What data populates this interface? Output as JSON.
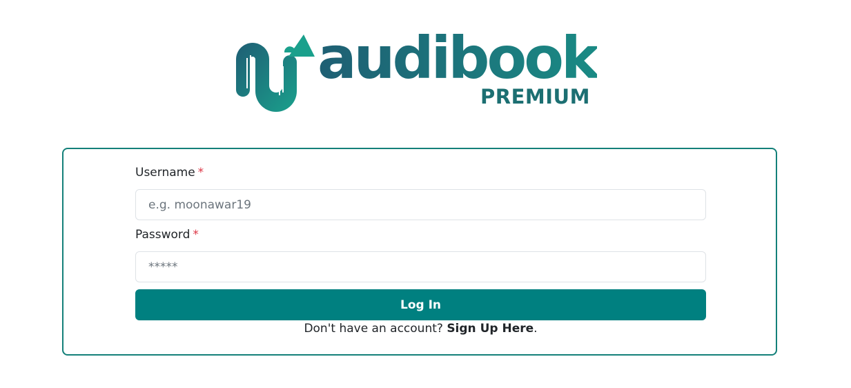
{
  "brand": {
    "name": "audibook",
    "tier": "PREMIUM",
    "color_dark": "#1e5f73",
    "color_light": "#1a9a88"
  },
  "form": {
    "username": {
      "label": "Username",
      "required_mark": "*",
      "placeholder": "e.g. moonawar19",
      "value": ""
    },
    "password": {
      "label": "Password",
      "required_mark": "*",
      "placeholder": "*****",
      "value": ""
    },
    "submit_label": "Log In",
    "signup_prompt": "Don't have an account?",
    "signup_link": "Sign Up Here",
    "signup_suffix": "."
  },
  "colors": {
    "accent": "#008080",
    "border": "#138079",
    "required": "#dc3545"
  }
}
